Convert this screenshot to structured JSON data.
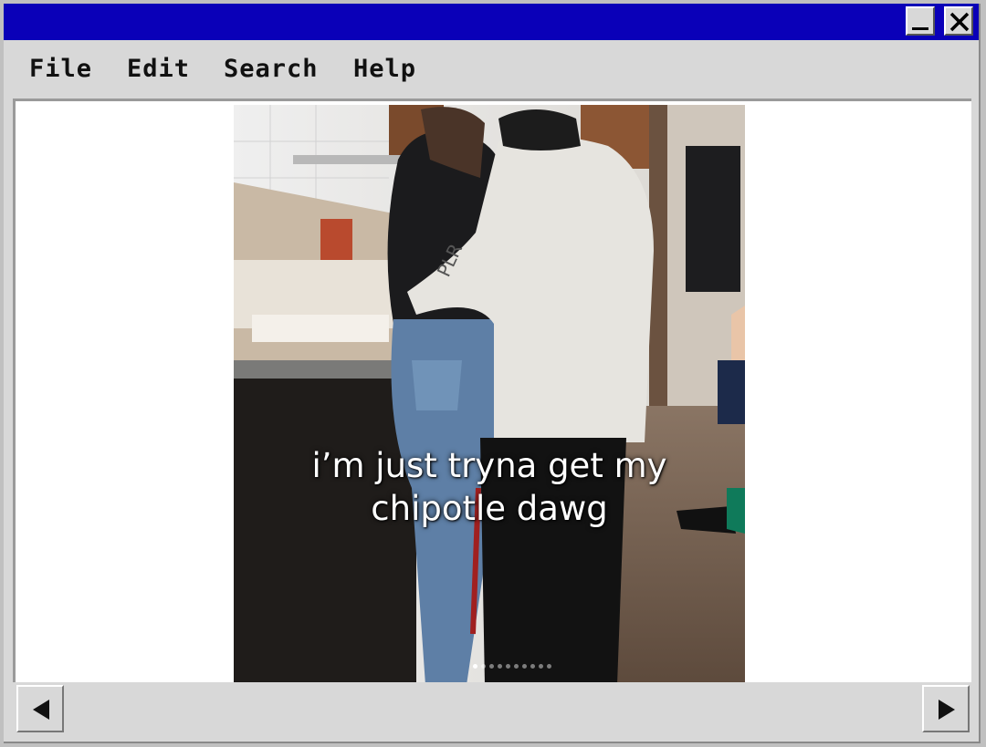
{
  "window": {
    "title_bar_color": "#0a00b8",
    "controls": {
      "minimize_icon": "minimize-icon",
      "close_icon": "close-icon"
    }
  },
  "menu": [
    {
      "label": "File"
    },
    {
      "label": "Edit"
    },
    {
      "label": "Search"
    },
    {
      "label": "Help"
    }
  ],
  "media": {
    "caption_line1": "i’m just tryna get my",
    "caption_line2": "chipotle dawg",
    "carousel_count": 10,
    "carousel_active": 0
  },
  "scrollbar": {
    "left_icon": "arrow-left-icon",
    "right_icon": "arrow-right-icon"
  }
}
